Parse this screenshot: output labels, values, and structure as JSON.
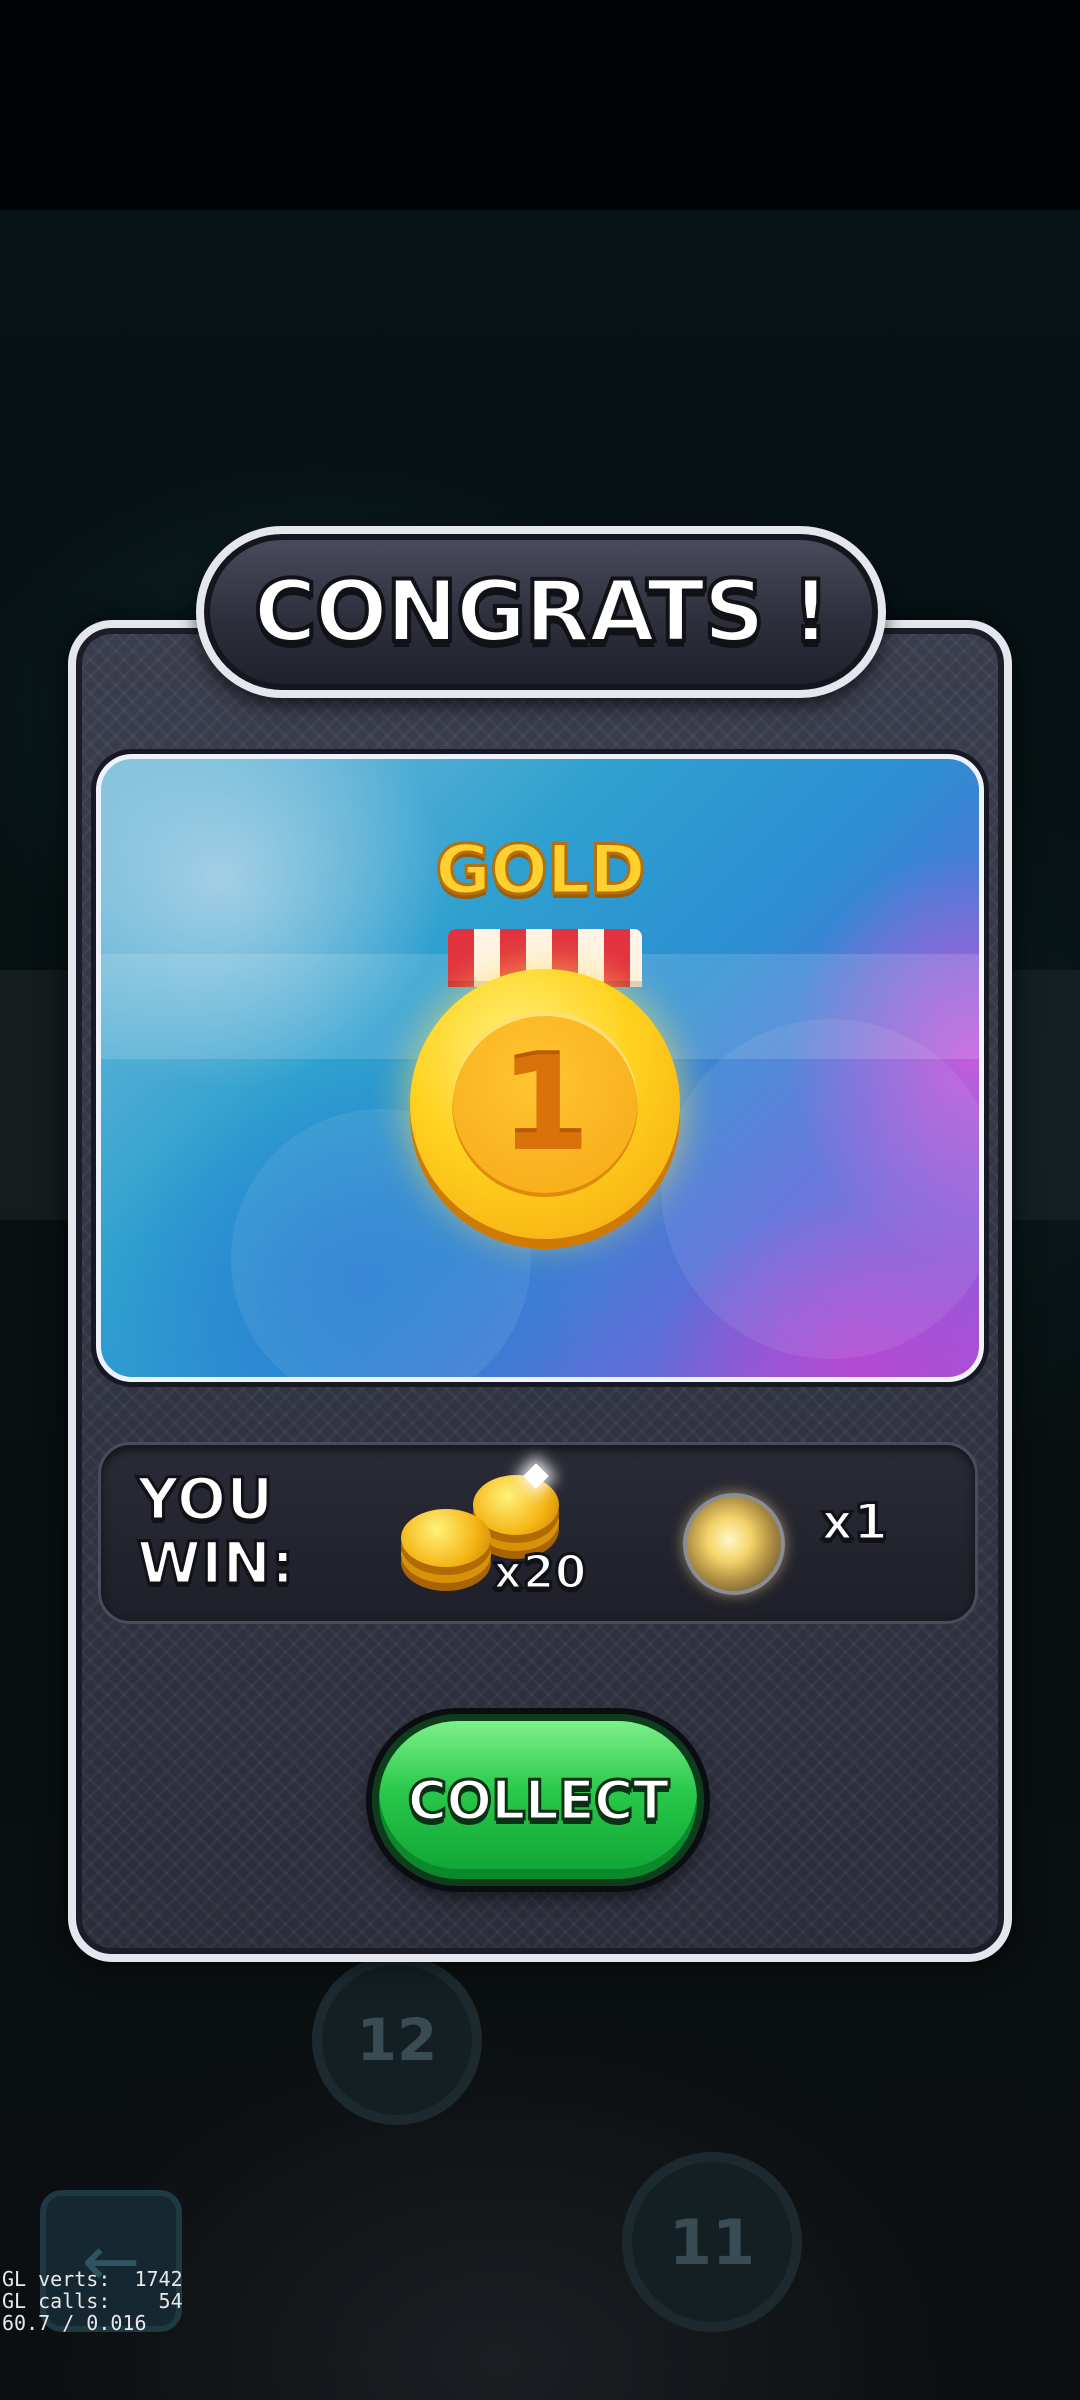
{
  "popup": {
    "title": "CONGRATS !",
    "medal_label": "GOLD",
    "medal_rank": "1"
  },
  "rewards": {
    "label": "YOU WIN:",
    "items": [
      {
        "icon": "gold-coins-icon",
        "count": "x20"
      },
      {
        "icon": "glowing-orb-icon",
        "count": "x1"
      }
    ]
  },
  "collect_button": {
    "label": "COLLECT"
  },
  "background": {
    "level_badges": [
      "12",
      "11"
    ]
  },
  "debug_overlay": {
    "line1": "GL verts:  1742",
    "line2": "GL calls:    54",
    "line3": "60.7 / 0.016"
  },
  "colors": {
    "accent_green": "#28c84a",
    "gold": "#ffd02e",
    "panel": "#2b2d3a"
  }
}
